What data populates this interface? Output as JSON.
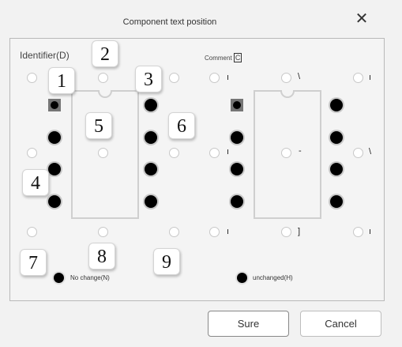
{
  "dialog": {
    "title": "Component text position",
    "close_label": "✕"
  },
  "groups": {
    "identifier": {
      "label": "Identifier(D)",
      "selected_label": "No change(N)"
    },
    "comment": {
      "label": "Comment",
      "mnemonic": "C",
      "selected_label": "unchanged(H)"
    }
  },
  "comment_glyphs": [
    "ı",
    "\\",
    "ı",
    "-",
    "\\",
    "ı",
    "]",
    "ı"
  ],
  "callouts": [
    "1",
    "2",
    "3",
    "4",
    "5",
    "6",
    "7",
    "8",
    "9"
  ],
  "buttons": {
    "ok": "Sure",
    "cancel": "Cancel"
  }
}
